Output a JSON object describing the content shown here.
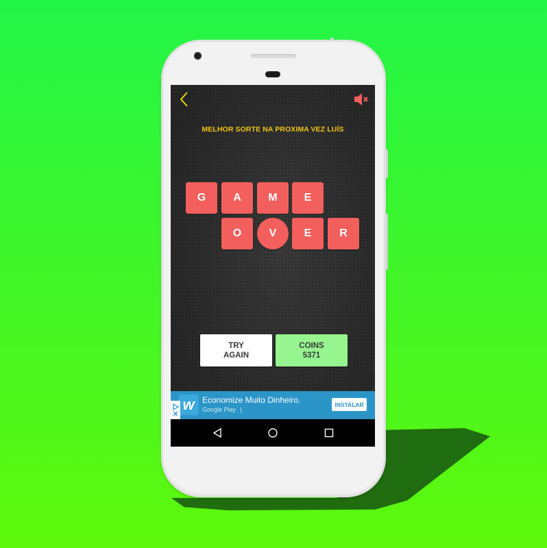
{
  "background": {
    "color_top": "#22f548",
    "color_bottom": "#5ef80c"
  },
  "header": {
    "back_icon": "chevron-left-icon",
    "mute_icon": "speaker-muted-icon",
    "icon_color_back": "#f2e313",
    "icon_color_mute": "#f25f5c"
  },
  "message": "MELHOR SORTE NA PROXIMA VEZ LUÍS",
  "game_over": {
    "row1": [
      "G",
      "A",
      "M",
      "E"
    ],
    "row2": [
      "O",
      "V",
      "E",
      "R"
    ],
    "tile_color": "#f25f5c"
  },
  "buttons": {
    "try_again": {
      "line1": "TRY",
      "line2": "AGAIN"
    },
    "coins": {
      "label": "COINS",
      "value": "5371"
    }
  },
  "ad": {
    "title": "Economize Muito Dinheiro.",
    "subtitle": "Google Play",
    "separator": "|",
    "cta": "INSTALAR",
    "logo_letter": "w",
    "ad_choices_icon": "adchoices-icon",
    "close_icon": "close-icon"
  },
  "navbar": {
    "back": "nav-back-icon",
    "home": "nav-home-icon",
    "recents": "nav-recents-icon"
  }
}
